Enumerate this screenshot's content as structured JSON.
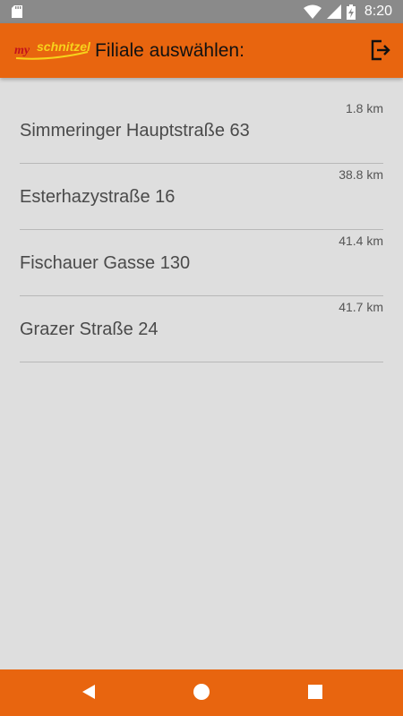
{
  "status_bar": {
    "time": "8:20",
    "icons": [
      "sd-card-icon",
      "wifi-icon",
      "signal-icon",
      "battery-charging-icon"
    ]
  },
  "app_bar": {
    "logo_prefix": "my",
    "logo_name": "schnitzel",
    "title": "Filiale auswählen:",
    "logout_icon": "logout-icon"
  },
  "branches": [
    {
      "name": "Simmeringer Hauptstraße 63",
      "distance": "1.8 km"
    },
    {
      "name": "Esterhazystraße 16",
      "distance": "38.8 km"
    },
    {
      "name": "Fischauer Gasse 130",
      "distance": "41.4 km"
    },
    {
      "name": "Grazer Straße 24",
      "distance": "41.7 km"
    }
  ],
  "nav_bar": {
    "icons": [
      "back-icon",
      "home-icon",
      "recents-icon"
    ]
  },
  "colors": {
    "accent": "#e8650f",
    "status_bar": "#8a8a8a",
    "background": "#dedede",
    "logo_red": "#c2121c",
    "logo_yellow": "#f7d21c"
  }
}
